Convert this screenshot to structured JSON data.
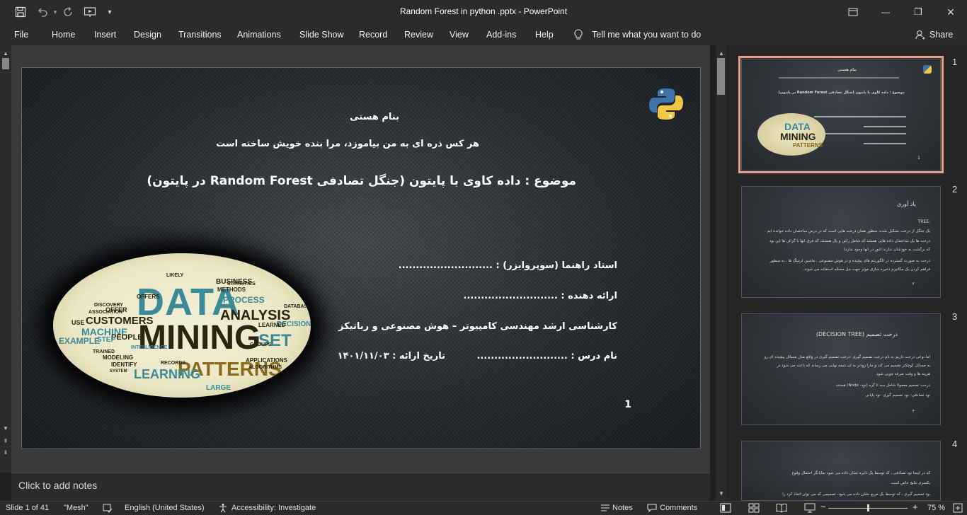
{
  "window": {
    "title": "Random Forest in python .pptx  -  PowerPoint",
    "minimize": "—",
    "restore": "❐",
    "close": "✕"
  },
  "quick_access": {
    "save_icon": "save-icon",
    "undo_icon": "undo-icon",
    "redo_icon": "redo-icon",
    "present_icon": "present-icon",
    "customize_icon": "customize-icon"
  },
  "ribbon": {
    "tabs": [
      "File",
      "Home",
      "Insert",
      "Design",
      "Transitions",
      "Animations",
      "Slide Show",
      "Record",
      "Review",
      "View",
      "Add-ins",
      "Help"
    ],
    "tell_me": "Tell me what you want to do",
    "share": "Share"
  },
  "slide": {
    "line1": "بنام هستی",
    "line2": "هر کس ذره ای به من بیاموزد، مرا بنده خویش ساخته است",
    "title": "موضوع : داده کاوی با پایتون (جنگل تصادفی Random  Forest در پایتون)",
    "advisor": "استاد راهنما (سوپروایزر) : ...........................",
    "presenter": "ارائه دهنده : ...........................",
    "degree": "کارشناسی ارشد مهندسی کامپیوتر – هوش مصنوعی و رباتیکز",
    "course": "نام درس : ..........................",
    "date": "تاریخ ارائه : ۱۴۰۱/۱۱/۰۳",
    "page_number": "1",
    "word_cloud": {
      "data": "DATA",
      "mining": "MINING",
      "patterns": "PATTERNS",
      "analysis": "ANALYSIS",
      "customers": "CUSTOMERS",
      "machine": "MACHINE",
      "example": "EXAMPLE",
      "learning": "LEARNING",
      "process": "PROCESS",
      "business": "BUSINESS",
      "set": "SET",
      "large": "LARGE",
      "people": "PEOPLE",
      "decision": "DECISION",
      "learned": "LEARNED",
      "methods": "METHODS",
      "offer": "OFFER",
      "step": "STEP",
      "use": "USE",
      "modeling": "MODELING",
      "records": "RECORDS",
      "applications": "APPLICATIONS",
      "algorithms": "ALGORITHMS",
      "database": "DATABASE",
      "intelligence": "INTELLIGENCE",
      "statistics": "STATISTICS",
      "discovery": "DISCOVERY",
      "association": "ASSOCIATION",
      "offers": "OFFERS",
      "likely": "LIKELY",
      "groups": "GROUPS",
      "trained": "TRAINED",
      "identify": "IDENTIFY",
      "system": "SYSTEM"
    }
  },
  "thumbnails": [
    {
      "number": "1",
      "lines": [
        "بنام هستی",
        "موضوع : داده کاوی با پایتون (جنگل تصادفی Random Forest در پایتون)",
        "DATA",
        "MINING",
        "PATTERNS",
        "1"
      ]
    },
    {
      "number": "2",
      "title": "یاد آوری",
      "label": "TREE:",
      "lines": [
        "یک جنگل از درخت تشکیل شده، منظور همان درخت هایی است که در درس ساختمان داده خوانده ایم .",
        "درخت ها یک ساختمان داده هایی هستند که شامل راس و یال هستند، که فرق انها با گراف ها این بود",
        "که برگشت به خودشان ندارند (دور در انها وجود ندارد)",
        "درخت به صورت گسترده در الگوریتم های پیچیده و در هوش مصنوعی ، ماشین لرنینگ ها ، به منظور",
        "فراهم کردن یک مکانیزم ذخیره سازی موثر جهت حل مسئله استفاده می شوند.",
        "۲"
      ]
    },
    {
      "number": "3",
      "title": "درخت تصمیم (DECISION TREE)",
      "lines": [
        "اما نوعی درخت داریم به نام درخت تصمیم گیری :درخت تصمیم گیری در واقع مدل مسائل پیچیده ای رو",
        "به مسائل کوچکتر تقسیم می کند و مارا زودتر به ان نتیجه نهایی می رساند که باعث می شود در",
        "هزینه ها و وقت صرفه جویی شود",
        "درخت تصمیم معمولا شامل سه تا گره (نود- Node) هستند",
        "نود تصادفی- نود تصمیم گیری -نود پایانی",
        "۳"
      ]
    },
    {
      "number": "4",
      "lines": [
        "که در اینجا نود تصادفی ، که توسط یک دایره نشان داده می شود نمایانگر احتمال وقوع",
        "یکسری نتایج خاص است",
        "نود تصمیم گیری ، که توسط یک مربع نشان داده می شود، تصمیمی که می توان اتخاذ کرد را"
      ]
    }
  ],
  "notes": {
    "placeholder": "Click to add notes"
  },
  "status": {
    "slide": "Slide 1 of 41",
    "theme": "\"Mesh\"",
    "language": "English (United States)",
    "accessibility": "Accessibility: Investigate",
    "notes": "Notes",
    "comments": "Comments",
    "zoom_minus": "−",
    "zoom_plus": "+",
    "zoom": "75 %",
    "zoom_fraction": 0.5
  },
  "colors": {
    "selected_thumb_border": "#e8a08a",
    "app_dark": "#2b2b2b",
    "wordcloud_teal": "#3a8a97",
    "wordcloud_dark": "#2a2410"
  }
}
